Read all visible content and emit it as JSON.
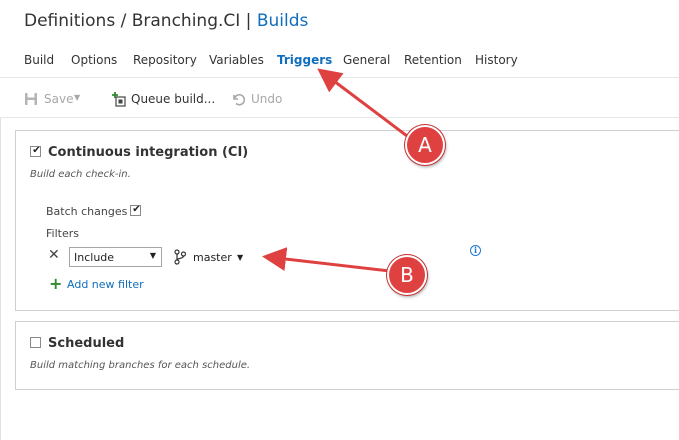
{
  "breadcrumb": {
    "root": "Definitions",
    "separator1": " / ",
    "definition": "Branching.CI",
    "separator2": " | ",
    "section": "Builds"
  },
  "tabs": [
    {
      "label": "Build"
    },
    {
      "label": "Options"
    },
    {
      "label": "Repository"
    },
    {
      "label": "Variables"
    },
    {
      "label": "Triggers",
      "active": true
    },
    {
      "label": "General"
    },
    {
      "label": "Retention"
    },
    {
      "label": "History"
    }
  ],
  "toolbar": {
    "save_label": "Save",
    "queue_label": "Queue build...",
    "undo_label": "Undo"
  },
  "ci": {
    "checked": true,
    "title": "Continuous integration (CI)",
    "description": "Build each check-in.",
    "batch_label": "Batch changes",
    "batch_checked": true,
    "filters_label": "Filters",
    "filter_type": "Include",
    "branch": "master",
    "add_filter_label": "Add new filter",
    "info_glyph": "i"
  },
  "scheduled": {
    "checked": false,
    "title": "Scheduled",
    "description": "Build matching branches for each schedule."
  },
  "callouts": {
    "a": "A",
    "b": "B"
  },
  "colors": {
    "link": "#106ebe",
    "callout": "#df4040",
    "add_icon": "#2e8b2e"
  }
}
